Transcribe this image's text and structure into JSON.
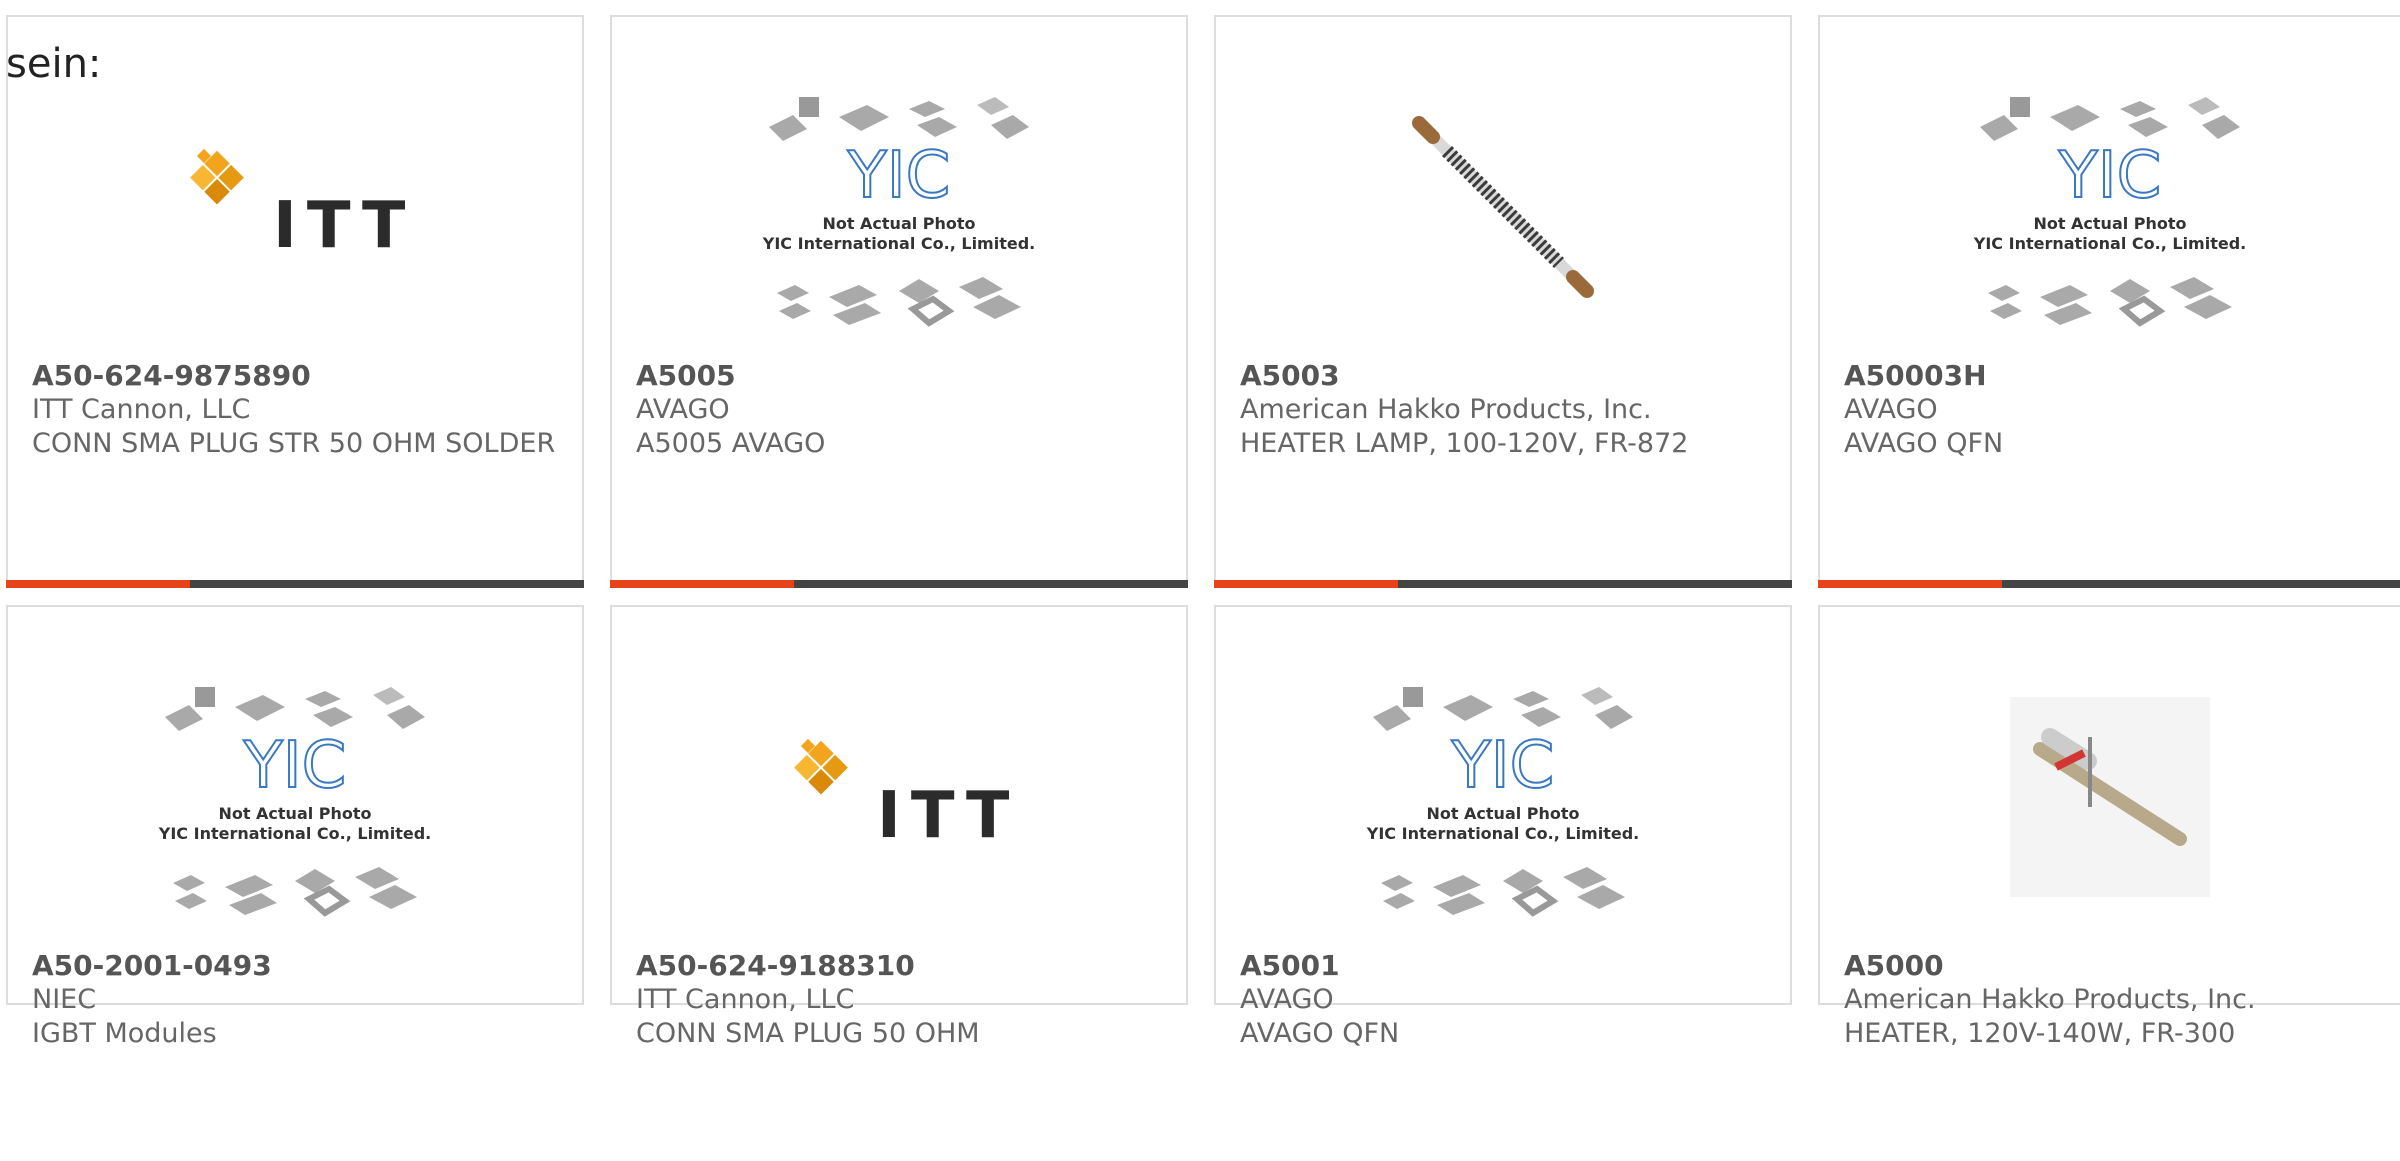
{
  "intro_text": "sein:",
  "placeholder": {
    "not_actual": "Not Actual Photo",
    "company": "YIC International Co., Limited.",
    "logo_text": "YIC"
  },
  "itt_logo_text": "ITT",
  "products": [
    {
      "part": "A50-624-9875890",
      "maker": "ITT Cannon, LLC",
      "desc": "CONN SMA PLUG STR 50 OHM SOLDER",
      "image": "itt-logo"
    },
    {
      "part": "A5005",
      "maker": "AVAGO",
      "desc": "A5005 AVAGO",
      "image": "yic-placeholder"
    },
    {
      "part": "A5003",
      "maker": "American Hakko Products, Inc.",
      "desc": "HEATER LAMP, 100-120V, FR-872",
      "image": "heater-lamp"
    },
    {
      "part": "A50003H",
      "maker": "AVAGO",
      "desc": "AVAGO QFN",
      "image": "yic-placeholder"
    },
    {
      "part": "A50-2001-0493",
      "maker": "NIEC",
      "desc": "IGBT Modules",
      "image": "yic-placeholder"
    },
    {
      "part": "A50-624-9188310",
      "maker": "ITT Cannon, LLC",
      "desc": "CONN SMA PLUG 50 OHM",
      "image": "itt-logo"
    },
    {
      "part": "A5001",
      "maker": "AVAGO",
      "desc": "AVAGO QFN",
      "image": "yic-placeholder"
    },
    {
      "part": "A5000",
      "maker": "American Hakko Products, Inc.",
      "desc": "HEATER, 120V-140W, FR-300",
      "image": "heater-element"
    }
  ],
  "colors": {
    "accent": "#e8441a",
    "bar": "#444444",
    "border": "#dddddd",
    "itt_orange": "#f2a51c"
  }
}
